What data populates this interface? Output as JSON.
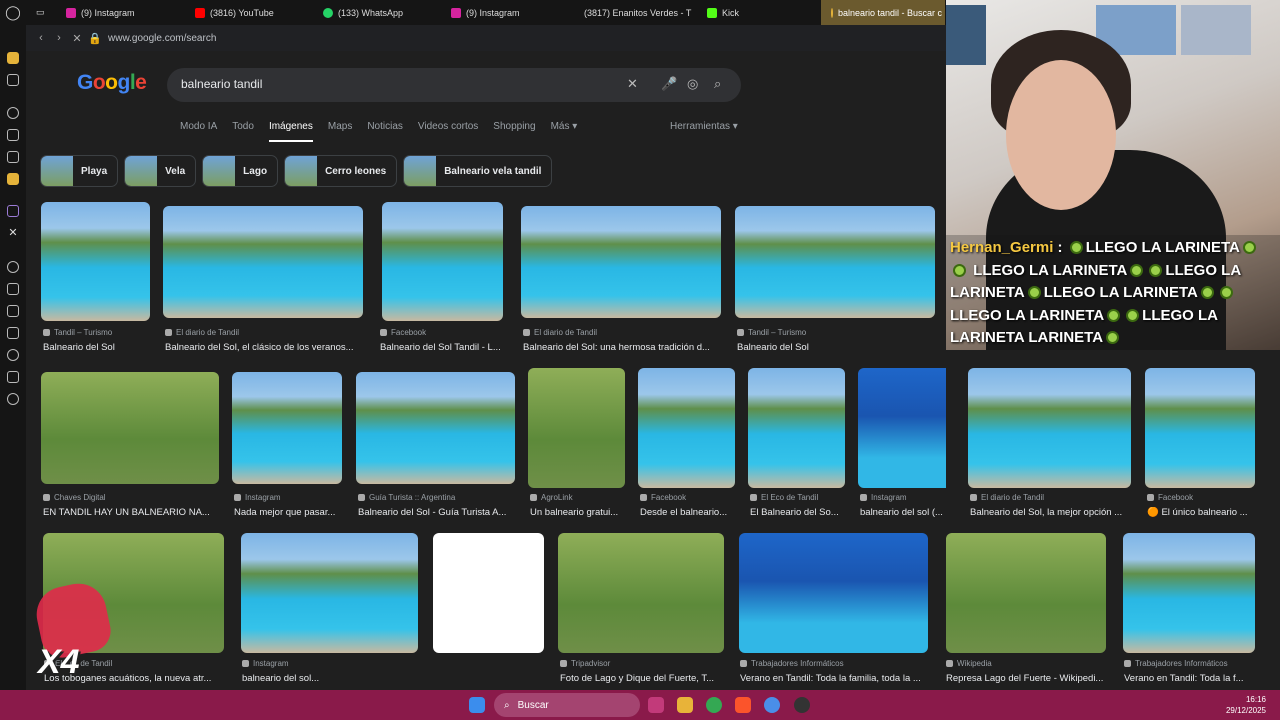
{
  "browser_tabs": [
    {
      "label": "(9) Instagram",
      "color": "#d6249f"
    },
    {
      "label": "(3816) YouTube",
      "color": "#ff0000"
    },
    {
      "label": "(133) WhatsApp",
      "color": "#25d366"
    },
    {
      "label": "(9) Instagram",
      "color": "#d6249f"
    },
    {
      "label": "(3817) Enanitos Verdes - T",
      "color": "#ff0000"
    },
    {
      "label": "Kick",
      "color": "#53fc18"
    },
    {
      "label": "balneario tandil - Buscar c",
      "color": "#e5b33a"
    }
  ],
  "address_bar": {
    "url": "www.google.com/search"
  },
  "google": {
    "logo": "Google",
    "query": "balneario tandil",
    "nav_tabs": [
      "Modo IA",
      "Todo",
      "Imágenes",
      "Maps",
      "Noticias",
      "Videos cortos",
      "Shopping",
      "Más"
    ],
    "active_tab": "Imágenes",
    "tools": "Herramientas",
    "chips": [
      "Playa",
      "Vela",
      "Lago",
      "Cerro leones",
      "Balneario vela tandil"
    ]
  },
  "results": [
    {
      "source": "Tandil – Turismo",
      "title": "Balneario del Sol"
    },
    {
      "source": "El diario de Tandil",
      "title": "Balneario del Sol, el clásico de los veranos..."
    },
    {
      "source": "Facebook",
      "title": "Balneario del Sol Tandil - L..."
    },
    {
      "source": "El diario de Tandil",
      "title": "Balneario del Sol: una hermosa tradición d..."
    },
    {
      "source": "Tandil – Turismo",
      "title": "Balneario del Sol"
    },
    {
      "source": "Chaves Digital",
      "title": "EN TANDIL HAY UN BALNEARIO NA..."
    },
    {
      "source": "Instagram",
      "title": "Nada mejor que pasar..."
    },
    {
      "source": "Guía Turista :: Argentina",
      "title": "Balneario del Sol - Guía Turista A..."
    },
    {
      "source": "AgroLink",
      "title": "Un balneario gratui..."
    },
    {
      "source": "Facebook",
      "title": "Desde el balneario..."
    },
    {
      "source": "El Eco de Tandil",
      "title": "El Balneario del So..."
    },
    {
      "source": "Instagram",
      "title": "balneario del sol (..."
    },
    {
      "source": "El diario de Tandil",
      "title": "Balneario del Sol, la mejor opción ..."
    },
    {
      "source": "Facebook",
      "title": "🟠 El único balneario ..."
    },
    {
      "source": "El Eco de Tandil",
      "title": "Los toboganes acuáticos, la nueva atr..."
    },
    {
      "source": "Instagram",
      "title": "balneario del sol..."
    },
    {
      "source": "Tripadvisor",
      "title": "Foto de Lago y Dique del Fuerte, T..."
    },
    {
      "source": "Trabajadores Informáticos",
      "title": "Verano en Tandil: Toda la familia, toda la ..."
    },
    {
      "source": "Wikipedia",
      "title": "Represa Lago del Fuerte - Wikipedi..."
    },
    {
      "source": "Trabajadores Informáticos",
      "title": "Verano en Tandil: Toda la f..."
    }
  ],
  "chat": {
    "user": "Hernan_Germi",
    "message": "LLEGO LA LARINETA",
    "tail": "LARINETA"
  },
  "badge": {
    "multiplier": "X4"
  },
  "taskbar": {
    "search": "Buscar",
    "time": "16:16",
    "date": "29/12/2025"
  }
}
